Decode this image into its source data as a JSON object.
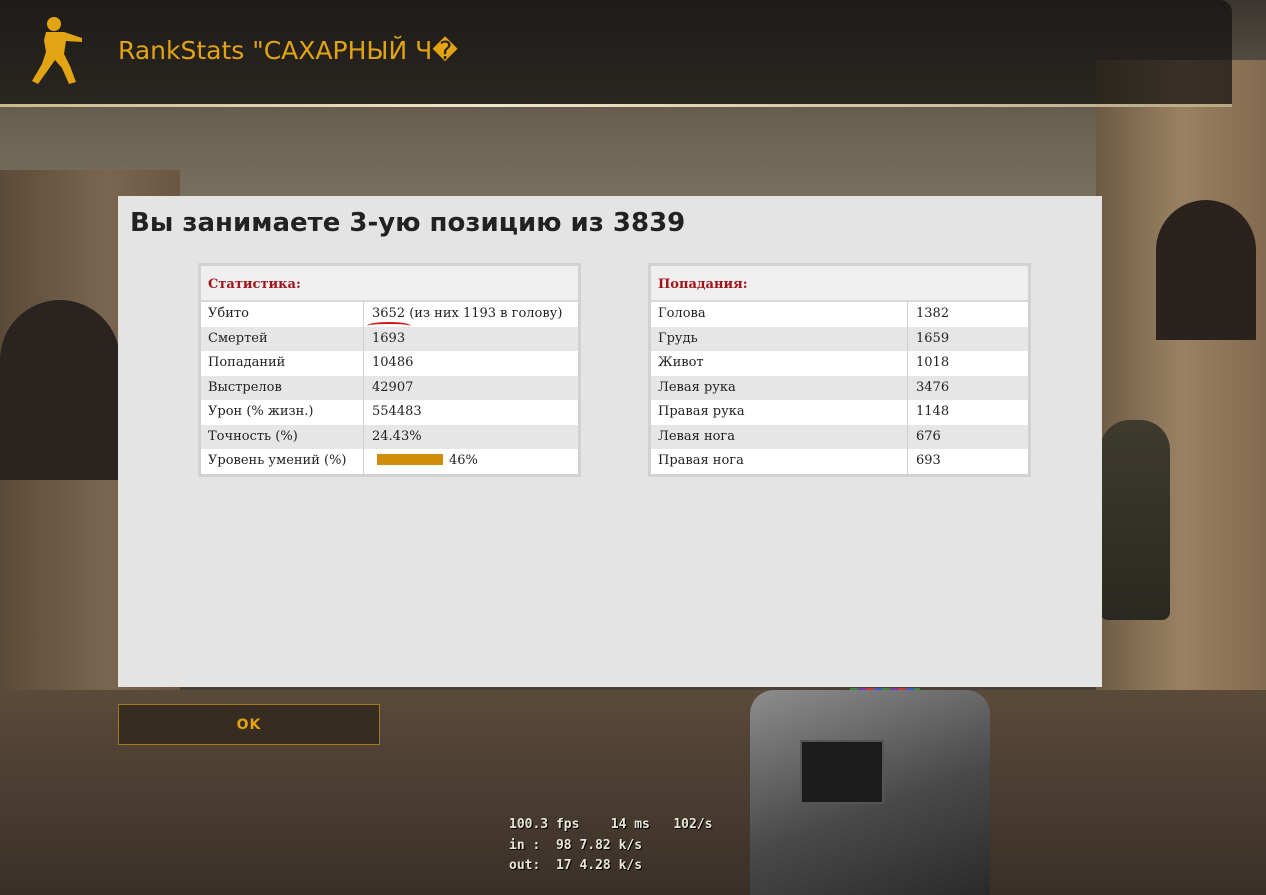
{
  "header": {
    "title": "RankStats \"САХАРНЫЙ Ч�",
    "logo_icon": "counter-strike-soldier-icon",
    "accent_color": "#e3a414"
  },
  "panel": {
    "heading": "Вы занимаете 3-ую позицию из 3839"
  },
  "stats": {
    "title": "Статистика:",
    "rows": [
      {
        "label": "Убито",
        "value": "3652  (из них 1193 в голову)"
      },
      {
        "label": "Смертей",
        "value": "1693"
      },
      {
        "label": "Попаданий",
        "value": "10486"
      },
      {
        "label": "Выстрелов",
        "value": "42907"
      },
      {
        "label": "Урон (% жизн.)",
        "value": "554483"
      },
      {
        "label": "Точность (%)",
        "value": "24.43%"
      },
      {
        "label": "Уровень умений (%)",
        "value": "46%"
      }
    ],
    "skill_level": 46,
    "skill_bar_color": "#d08c0a"
  },
  "hits": {
    "title": "Попадания:",
    "rows": [
      {
        "label": "Голова",
        "value": "1382"
      },
      {
        "label": "Грудь",
        "value": "1659"
      },
      {
        "label": "Живот",
        "value": "1018"
      },
      {
        "label": "Левая рука",
        "value": "3476"
      },
      {
        "label": "Правая рука",
        "value": "1148"
      },
      {
        "label": "Левая нога",
        "value": "676"
      },
      {
        "label": "Правая нога",
        "value": "693"
      }
    ]
  },
  "buttons": {
    "ok_label": "OK"
  },
  "netgraph": {
    "line1": "100.3 fps    14 ms   102/s",
    "line2": "in :  98 7.82 k/s",
    "line3": "out:  17 4.28 k/s"
  }
}
